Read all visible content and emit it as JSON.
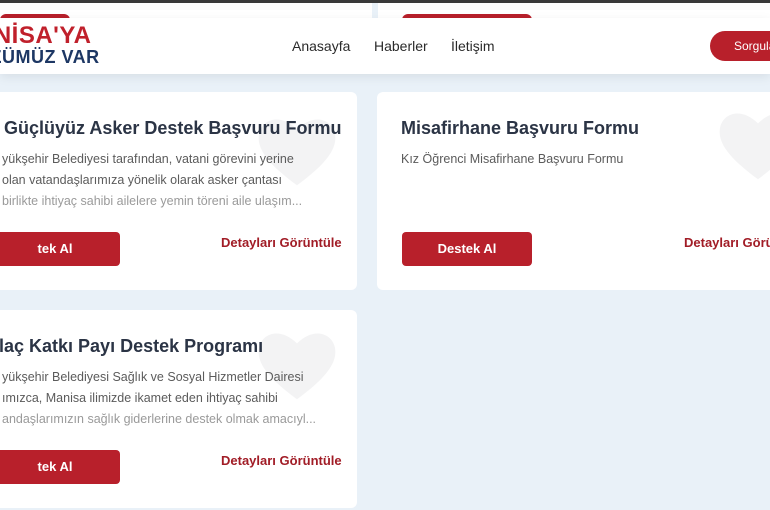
{
  "brand": {
    "line1": "ANİSA'YA",
    "line2": "ÖZÜMÜZ VAR"
  },
  "nav": {
    "items": [
      "Anasayfa",
      "Haberler",
      "İletişim"
    ],
    "query_button": "Sorgula"
  },
  "cards": [
    {
      "title": "Güçlüyüz Asker Destek Başvuru Formu",
      "desc_lines": [
        "yükşehir Belediyesi tarafından, vatani görevini yerine",
        "olan vatandaşlarımıza yönelik olarak asker çantası",
        "birlikte ihtiyaç sahibi ailelere yemin töreni aile ulaşım..."
      ],
      "button": "tek Al",
      "details": "Detayları Görüntüle"
    },
    {
      "title": "Misafirhane Başvuru Formu",
      "desc_lines": [
        "Kız Öğrenci Misafirhane Başvuru Formu"
      ],
      "button": "Destek Al",
      "details": "Detayları Görün"
    },
    {
      "title": "İlaç Katkı Payı Destek Programı",
      "desc_lines": [
        "yükşehir Belediyesi Sağlık ve Sosyal Hizmetler Dairesi",
        "ımızca, Manisa ilimizde ikamet eden ihtiyaç sahibi",
        "andaşlarımızın sağlık giderlerine destek olmak amacıyl..."
      ],
      "button": "tek Al",
      "details": "Detayları Görüntüle"
    }
  ],
  "colors": {
    "brand_red": "#b8202b",
    "brand_navy": "#1d3764",
    "background": "#e9f1f8"
  }
}
